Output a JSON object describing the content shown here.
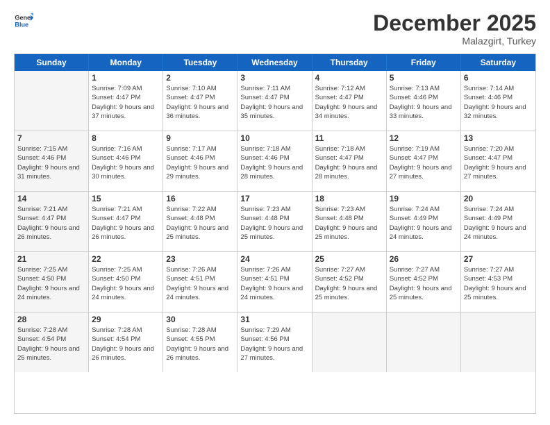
{
  "header": {
    "logo_line1": "General",
    "logo_line2": "Blue",
    "month": "December 2025",
    "location": "Malazgirt, Turkey"
  },
  "weekdays": [
    "Sunday",
    "Monday",
    "Tuesday",
    "Wednesday",
    "Thursday",
    "Friday",
    "Saturday"
  ],
  "weeks": [
    [
      {
        "day": "",
        "sunrise": "",
        "sunset": "",
        "daylight": "",
        "shaded": true
      },
      {
        "day": "1",
        "sunrise": "Sunrise: 7:09 AM",
        "sunset": "Sunset: 4:47 PM",
        "daylight": "Daylight: 9 hours and 37 minutes.",
        "shaded": false
      },
      {
        "day": "2",
        "sunrise": "Sunrise: 7:10 AM",
        "sunset": "Sunset: 4:47 PM",
        "daylight": "Daylight: 9 hours and 36 minutes.",
        "shaded": false
      },
      {
        "day": "3",
        "sunrise": "Sunrise: 7:11 AM",
        "sunset": "Sunset: 4:47 PM",
        "daylight": "Daylight: 9 hours and 35 minutes.",
        "shaded": false
      },
      {
        "day": "4",
        "sunrise": "Sunrise: 7:12 AM",
        "sunset": "Sunset: 4:47 PM",
        "daylight": "Daylight: 9 hours and 34 minutes.",
        "shaded": false
      },
      {
        "day": "5",
        "sunrise": "Sunrise: 7:13 AM",
        "sunset": "Sunset: 4:46 PM",
        "daylight": "Daylight: 9 hours and 33 minutes.",
        "shaded": false
      },
      {
        "day": "6",
        "sunrise": "Sunrise: 7:14 AM",
        "sunset": "Sunset: 4:46 PM",
        "daylight": "Daylight: 9 hours and 32 minutes.",
        "shaded": false
      }
    ],
    [
      {
        "day": "7",
        "sunrise": "Sunrise: 7:15 AM",
        "sunset": "Sunset: 4:46 PM",
        "daylight": "Daylight: 9 hours and 31 minutes.",
        "shaded": true
      },
      {
        "day": "8",
        "sunrise": "Sunrise: 7:16 AM",
        "sunset": "Sunset: 4:46 PM",
        "daylight": "Daylight: 9 hours and 30 minutes.",
        "shaded": false
      },
      {
        "day": "9",
        "sunrise": "Sunrise: 7:17 AM",
        "sunset": "Sunset: 4:46 PM",
        "daylight": "Daylight: 9 hours and 29 minutes.",
        "shaded": false
      },
      {
        "day": "10",
        "sunrise": "Sunrise: 7:18 AM",
        "sunset": "Sunset: 4:46 PM",
        "daylight": "Daylight: 9 hours and 28 minutes.",
        "shaded": false
      },
      {
        "day": "11",
        "sunrise": "Sunrise: 7:18 AM",
        "sunset": "Sunset: 4:47 PM",
        "daylight": "Daylight: 9 hours and 28 minutes.",
        "shaded": false
      },
      {
        "day": "12",
        "sunrise": "Sunrise: 7:19 AM",
        "sunset": "Sunset: 4:47 PM",
        "daylight": "Daylight: 9 hours and 27 minutes.",
        "shaded": false
      },
      {
        "day": "13",
        "sunrise": "Sunrise: 7:20 AM",
        "sunset": "Sunset: 4:47 PM",
        "daylight": "Daylight: 9 hours and 27 minutes.",
        "shaded": false
      }
    ],
    [
      {
        "day": "14",
        "sunrise": "Sunrise: 7:21 AM",
        "sunset": "Sunset: 4:47 PM",
        "daylight": "Daylight: 9 hours and 26 minutes.",
        "shaded": true
      },
      {
        "day": "15",
        "sunrise": "Sunrise: 7:21 AM",
        "sunset": "Sunset: 4:47 PM",
        "daylight": "Daylight: 9 hours and 26 minutes.",
        "shaded": false
      },
      {
        "day": "16",
        "sunrise": "Sunrise: 7:22 AM",
        "sunset": "Sunset: 4:48 PM",
        "daylight": "Daylight: 9 hours and 25 minutes.",
        "shaded": false
      },
      {
        "day": "17",
        "sunrise": "Sunrise: 7:23 AM",
        "sunset": "Sunset: 4:48 PM",
        "daylight": "Daylight: 9 hours and 25 minutes.",
        "shaded": false
      },
      {
        "day": "18",
        "sunrise": "Sunrise: 7:23 AM",
        "sunset": "Sunset: 4:48 PM",
        "daylight": "Daylight: 9 hours and 25 minutes.",
        "shaded": false
      },
      {
        "day": "19",
        "sunrise": "Sunrise: 7:24 AM",
        "sunset": "Sunset: 4:49 PM",
        "daylight": "Daylight: 9 hours and 24 minutes.",
        "shaded": false
      },
      {
        "day": "20",
        "sunrise": "Sunrise: 7:24 AM",
        "sunset": "Sunset: 4:49 PM",
        "daylight": "Daylight: 9 hours and 24 minutes.",
        "shaded": false
      }
    ],
    [
      {
        "day": "21",
        "sunrise": "Sunrise: 7:25 AM",
        "sunset": "Sunset: 4:50 PM",
        "daylight": "Daylight: 9 hours and 24 minutes.",
        "shaded": true
      },
      {
        "day": "22",
        "sunrise": "Sunrise: 7:25 AM",
        "sunset": "Sunset: 4:50 PM",
        "daylight": "Daylight: 9 hours and 24 minutes.",
        "shaded": false
      },
      {
        "day": "23",
        "sunrise": "Sunrise: 7:26 AM",
        "sunset": "Sunset: 4:51 PM",
        "daylight": "Daylight: 9 hours and 24 minutes.",
        "shaded": false
      },
      {
        "day": "24",
        "sunrise": "Sunrise: 7:26 AM",
        "sunset": "Sunset: 4:51 PM",
        "daylight": "Daylight: 9 hours and 24 minutes.",
        "shaded": false
      },
      {
        "day": "25",
        "sunrise": "Sunrise: 7:27 AM",
        "sunset": "Sunset: 4:52 PM",
        "daylight": "Daylight: 9 hours and 25 minutes.",
        "shaded": false
      },
      {
        "day": "26",
        "sunrise": "Sunrise: 7:27 AM",
        "sunset": "Sunset: 4:52 PM",
        "daylight": "Daylight: 9 hours and 25 minutes.",
        "shaded": false
      },
      {
        "day": "27",
        "sunrise": "Sunrise: 7:27 AM",
        "sunset": "Sunset: 4:53 PM",
        "daylight": "Daylight: 9 hours and 25 minutes.",
        "shaded": false
      }
    ],
    [
      {
        "day": "28",
        "sunrise": "Sunrise: 7:28 AM",
        "sunset": "Sunset: 4:54 PM",
        "daylight": "Daylight: 9 hours and 25 minutes.",
        "shaded": true
      },
      {
        "day": "29",
        "sunrise": "Sunrise: 7:28 AM",
        "sunset": "Sunset: 4:54 PM",
        "daylight": "Daylight: 9 hours and 26 minutes.",
        "shaded": false
      },
      {
        "day": "30",
        "sunrise": "Sunrise: 7:28 AM",
        "sunset": "Sunset: 4:55 PM",
        "daylight": "Daylight: 9 hours and 26 minutes.",
        "shaded": false
      },
      {
        "day": "31",
        "sunrise": "Sunrise: 7:29 AM",
        "sunset": "Sunset: 4:56 PM",
        "daylight": "Daylight: 9 hours and 27 minutes.",
        "shaded": false
      },
      {
        "day": "",
        "sunrise": "",
        "sunset": "",
        "daylight": "",
        "shaded": true
      },
      {
        "day": "",
        "sunrise": "",
        "sunset": "",
        "daylight": "",
        "shaded": true
      },
      {
        "day": "",
        "sunrise": "",
        "sunset": "",
        "daylight": "",
        "shaded": true
      }
    ]
  ]
}
